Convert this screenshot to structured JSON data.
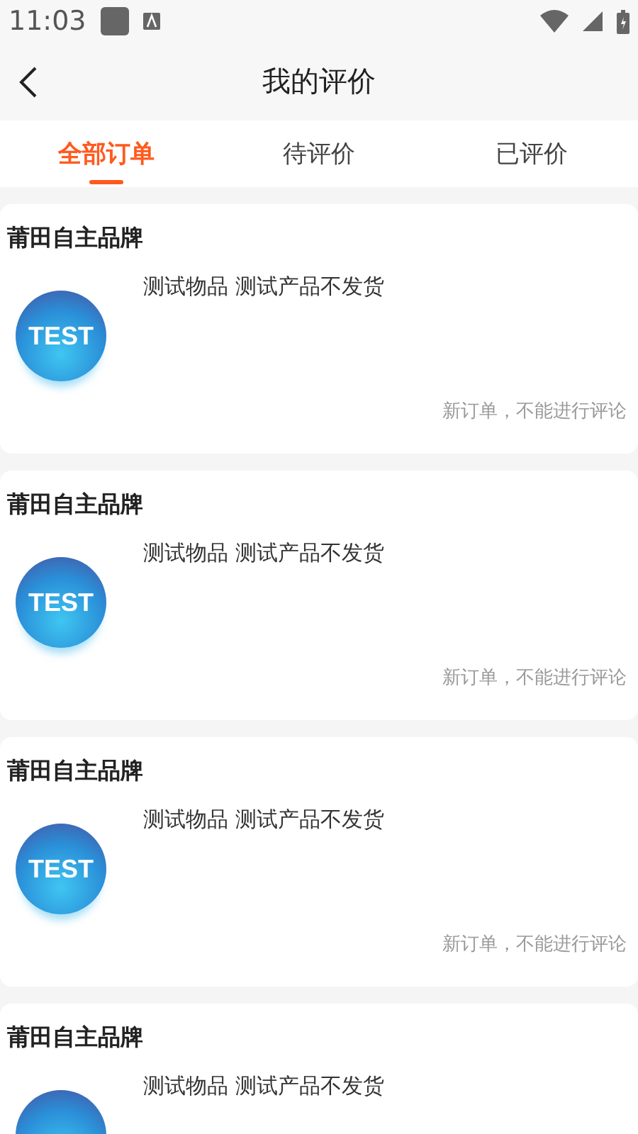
{
  "status_bar": {
    "time": "11:03"
  },
  "header": {
    "title": "我的评价"
  },
  "tabs": [
    {
      "label": "全部订单",
      "selected": true
    },
    {
      "label": "待评价",
      "selected": false
    },
    {
      "label": "已评价",
      "selected": false
    }
  ],
  "orders": [
    {
      "shop": "莆田自主品牌",
      "image_label": "TEST",
      "product": "测试物品 测试产品不发货",
      "status": "新订单，不能进行评论"
    },
    {
      "shop": "莆田自主品牌",
      "image_label": "TEST",
      "product": "测试物品 测试产品不发货",
      "status": "新订单，不能进行评论"
    },
    {
      "shop": "莆田自主品牌",
      "image_label": "TEST",
      "product": "测试物品 测试产品不发货",
      "status": "新订单，不能进行评论"
    },
    {
      "shop": "莆田自主品牌",
      "product": "测试物品 测试产品不发货"
    }
  ]
}
